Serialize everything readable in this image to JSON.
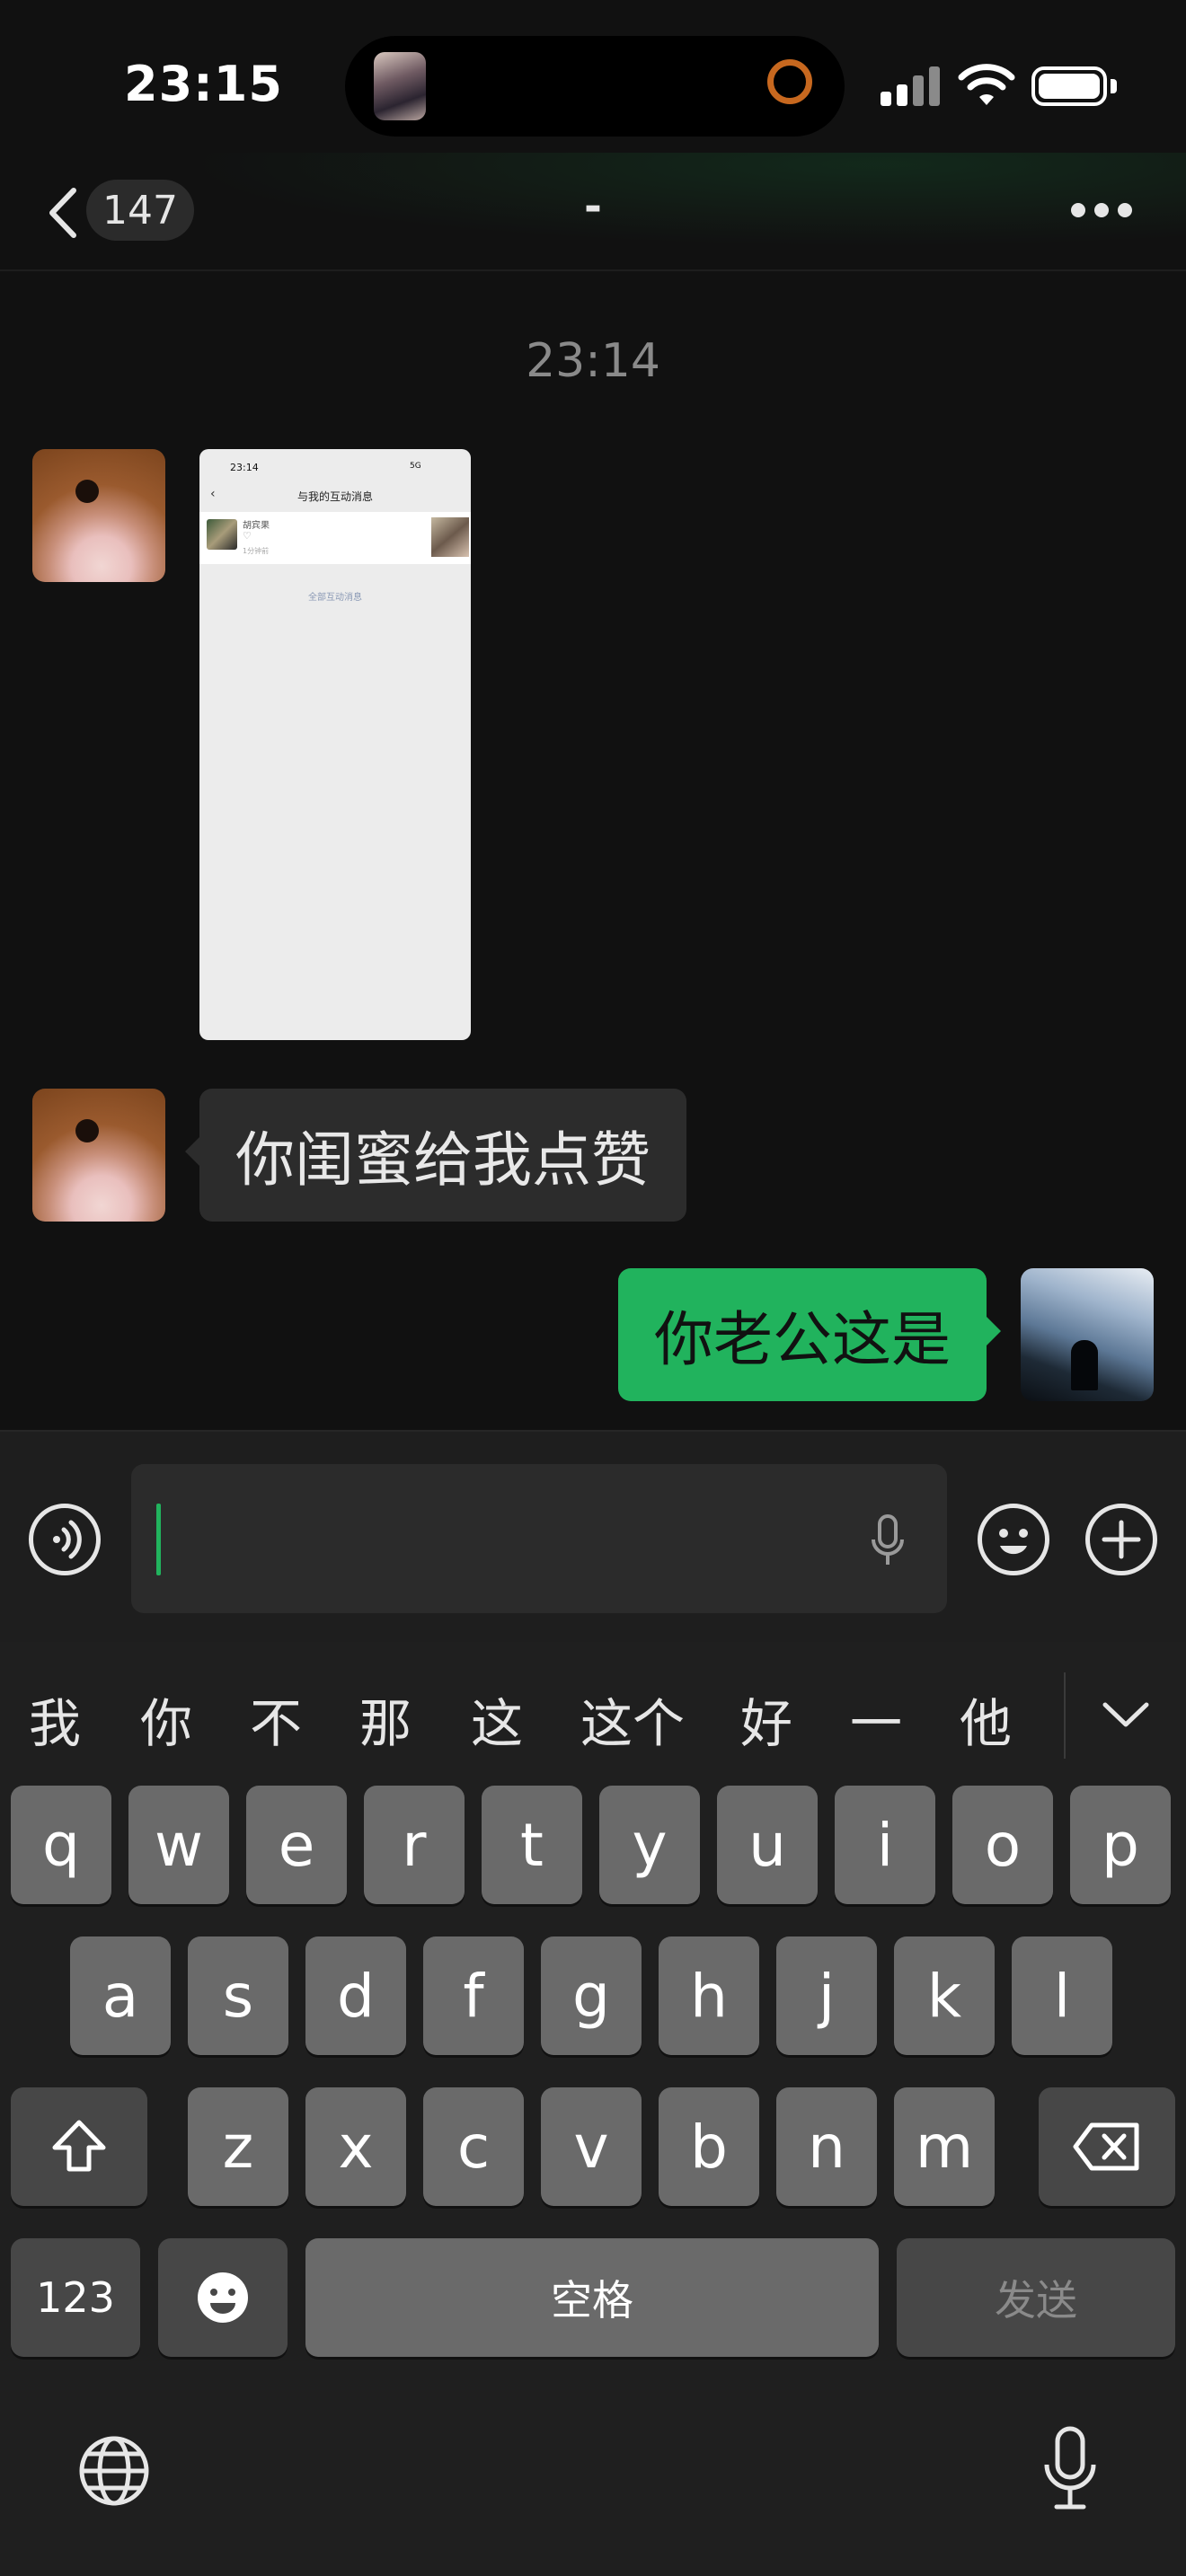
{
  "status_bar": {
    "time": "23:15"
  },
  "nav": {
    "unread_count": "147",
    "title": "-"
  },
  "chat": {
    "timestamp": "23:14",
    "screenshot_message": {
      "time": "23:14",
      "signal": "5G",
      "title": "与我的互动消息",
      "row_name": "胡宾果",
      "row_heart": "♡",
      "row_sub": "1分钟前",
      "footer_link": "全部互动消息"
    },
    "incoming_text": "你闺蜜给我点赞",
    "outgoing_text": "你老公这是"
  },
  "keyboard": {
    "candidates": [
      "我",
      "你",
      "不",
      "那",
      "这",
      "这个",
      "好",
      "一",
      "他"
    ],
    "row1": [
      "q",
      "w",
      "e",
      "r",
      "t",
      "y",
      "u",
      "i",
      "o",
      "p"
    ],
    "row2": [
      "a",
      "s",
      "d",
      "f",
      "g",
      "h",
      "j",
      "k",
      "l"
    ],
    "row3": [
      "z",
      "x",
      "c",
      "v",
      "b",
      "n",
      "m"
    ],
    "num_key": "123",
    "space_key": "空格",
    "send_key": "发送"
  },
  "colors": {
    "accent_green": "#21b35d",
    "background": "#111111",
    "bubble_in": "#2c2c2c"
  }
}
